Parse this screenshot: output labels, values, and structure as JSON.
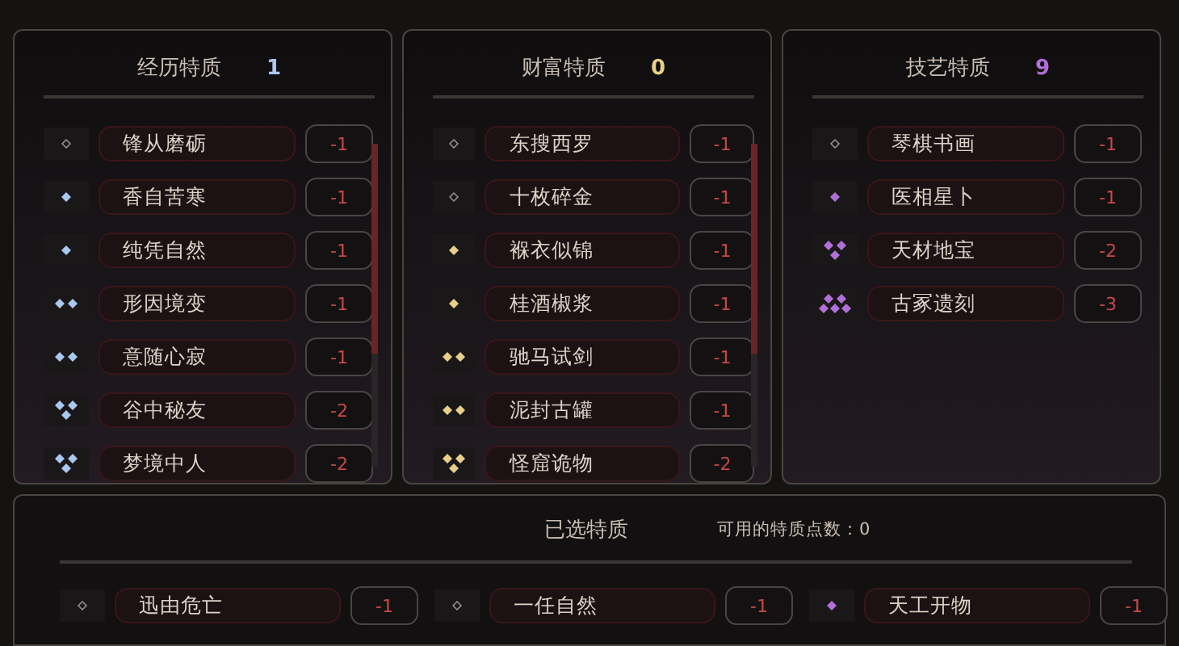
{
  "panels": [
    {
      "title": "经历特质",
      "count": "1",
      "color": "#a9c8f0",
      "scrollbar": true,
      "traits": [
        {
          "name": "锋从磨砺",
          "cost": "-1",
          "kind": "hollow"
        },
        {
          "name": "香自苦寒",
          "cost": "-1",
          "kind": "one"
        },
        {
          "name": "纯凭自然",
          "cost": "-1",
          "kind": "one"
        },
        {
          "name": "形因境变",
          "cost": "-1",
          "kind": "two"
        },
        {
          "name": "意随心寂",
          "cost": "-1",
          "kind": "two"
        },
        {
          "name": "谷中秘友",
          "cost": "-2",
          "kind": "three"
        },
        {
          "name": "梦境中人",
          "cost": "-2",
          "kind": "three"
        }
      ]
    },
    {
      "title": "财富特质",
      "count": "0",
      "color": "#e8d08a",
      "scrollbar": true,
      "traits": [
        {
          "name": "东搜西罗",
          "cost": "-1",
          "kind": "hollow"
        },
        {
          "name": "十枚碎金",
          "cost": "-1",
          "kind": "hollow"
        },
        {
          "name": "褓衣似锦",
          "cost": "-1",
          "kind": "one"
        },
        {
          "name": "桂酒椒浆",
          "cost": "-1",
          "kind": "one"
        },
        {
          "name": "驰马试剑",
          "cost": "-1",
          "kind": "two"
        },
        {
          "name": "泥封古罐",
          "cost": "-1",
          "kind": "two"
        },
        {
          "name": "怪窟诡物",
          "cost": "-2",
          "kind": "three"
        }
      ]
    },
    {
      "title": "技艺特质",
      "count": "9",
      "color": "#b070d8",
      "scrollbar": false,
      "traits": [
        {
          "name": "琴棋书画",
          "cost": "-1",
          "kind": "hollow"
        },
        {
          "name": "医相星卜",
          "cost": "-1",
          "kind": "one"
        },
        {
          "name": "天材地宝",
          "cost": "-2",
          "kind": "three"
        },
        {
          "name": "古冢遗刻",
          "cost": "-3",
          "kind": "five"
        }
      ]
    }
  ],
  "selected": {
    "title": "已选特质",
    "points": "可用的特质点数：0",
    "traits": [
      {
        "name": "迅由危亡",
        "cost": "-1",
        "kind": "hollow",
        "color": "#9a9a9a"
      },
      {
        "name": "一任自然",
        "cost": "-1",
        "kind": "hollow",
        "color": "#9a9a9a"
      },
      {
        "name": "天工开物",
        "cost": "-1",
        "kind": "one",
        "color": "#b070d8"
      }
    ]
  }
}
